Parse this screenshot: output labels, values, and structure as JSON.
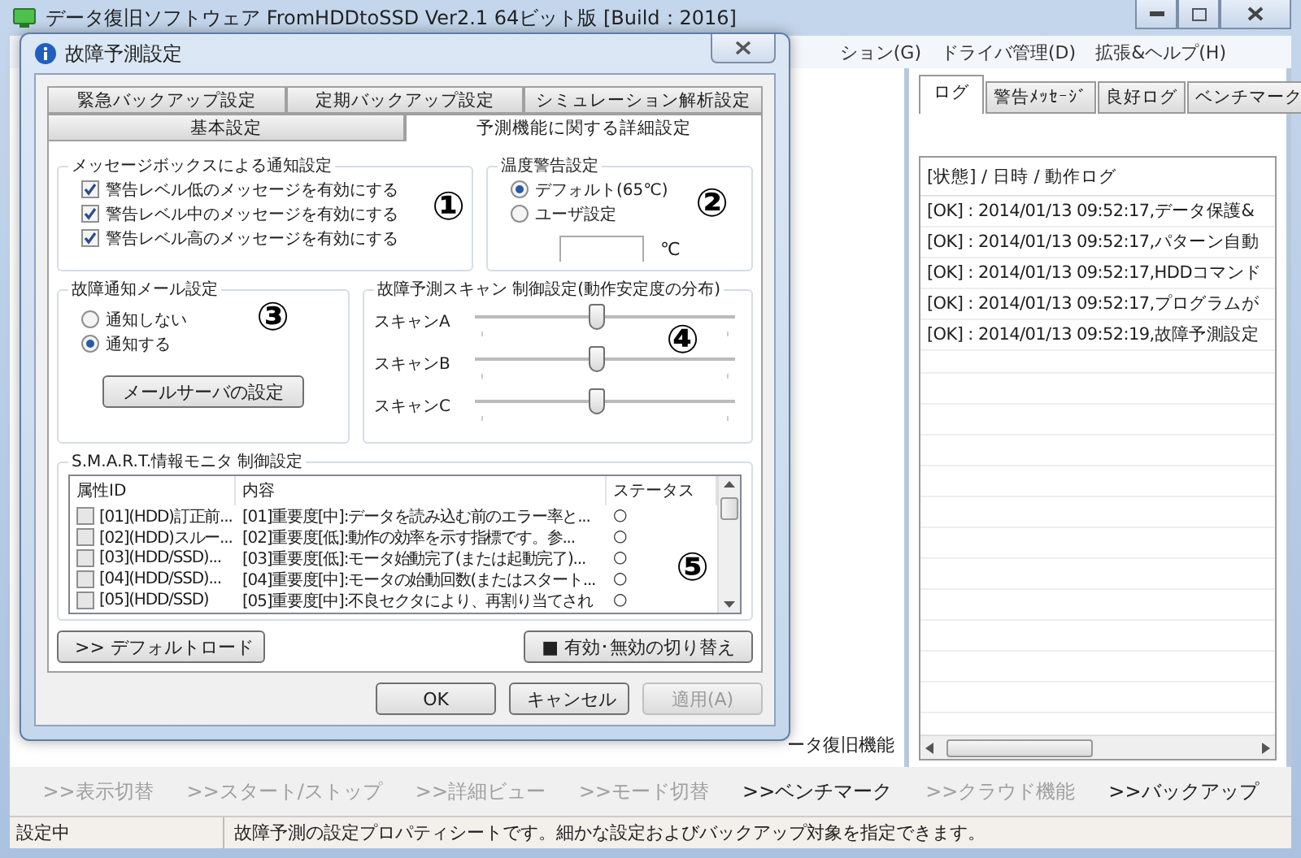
{
  "main_window": {
    "title": "データ復旧ソフトウェア FromHDDtoSSD Ver2.1 64ビット版 [Build：2016]"
  },
  "menu": [
    "ション(G)",
    "ドライバ管理(D)",
    "拡張&ヘルプ(H)"
  ],
  "background_label": "ータ復旧機能",
  "log_panel": {
    "tabs": [
      {
        "label": "ログ",
        "selected": true
      },
      {
        "label": "警告ﾒｯｾｰｼﾞ",
        "selected": false
      },
      {
        "label": "良好ログ",
        "selected": false
      },
      {
        "label": "ベンチマーク",
        "selected": false
      }
    ],
    "header": "[状態] / 日時 / 動作ログ",
    "rows": [
      "[OK] : 2014/01/13 09:52:17,データ保護&",
      "[OK] : 2014/01/13 09:52:17,パターン自動",
      "[OK] : 2014/01/13 09:52:17,HDDコマンド",
      "[OK] : 2014/01/13 09:52:17,プログラムが",
      "[OK] : 2014/01/13 09:52:19,故障予測設定"
    ]
  },
  "action_bar": [
    {
      "label": ">>表示切替",
      "disabled": true
    },
    {
      "label": ">>スタート/ストップ",
      "disabled": true
    },
    {
      "label": ">>詳細ビュー",
      "disabled": true
    },
    {
      "label": ">>モード切替",
      "disabled": true
    },
    {
      "label": ">>ベンチマーク",
      "disabled": false
    },
    {
      "label": ">>クラウド機能",
      "disabled": true
    },
    {
      "label": ">>バックアップ",
      "disabled": false
    }
  ],
  "status_bar": {
    "state": "設定中",
    "message": "故障予測の設定プロパティシートです。細かな設定およびバックアップ対象を指定できます。"
  },
  "dialog": {
    "title": "故障予測設定",
    "tabs_row_1": [
      {
        "label": "緊急バックアップ設定",
        "selected": false
      },
      {
        "label": "定期バックアップ設定",
        "selected": false
      },
      {
        "label": "シミュレーション解析設定",
        "selected": false
      }
    ],
    "tabs_row_2": [
      {
        "label": "基本設定",
        "selected": false
      },
      {
        "label": "予測機能に関する詳細設定",
        "selected": true
      }
    ],
    "message_group": {
      "title": "メッセージボックスによる通知設定",
      "marker": "①",
      "items": [
        {
          "label": "警告レベル低のメッセージを有効にする",
          "checked": true
        },
        {
          "label": "警告レベル中のメッセージを有効にする",
          "checked": true
        },
        {
          "label": "警告レベル高のメッセージを有効にする",
          "checked": true
        }
      ]
    },
    "temperature_group": {
      "title": "温度警告設定",
      "marker": "②",
      "options": [
        {
          "label": "デフォルト(65℃)",
          "selected": true
        },
        {
          "label": "ユーザ設定",
          "selected": false
        }
      ],
      "unit": "℃"
    },
    "mail_group": {
      "title": "故障通知メール設定",
      "marker": "③",
      "options": [
        {
          "label": "通知しない",
          "selected": false
        },
        {
          "label": "通知する",
          "selected": true
        }
      ],
      "button": "メールサーバの設定"
    },
    "scan_group": {
      "title": "故障予測スキャン 制御設定(動作安定度の分布)",
      "marker": "④",
      "sliders": [
        {
          "label": "スキャンA",
          "level": 0.47
        },
        {
          "label": "スキャンB",
          "level": 0.47
        },
        {
          "label": "スキャンC",
          "level": 0.47
        }
      ]
    },
    "smart_group": {
      "title": "S.M.A.R.T.情報モニタ 制御設定",
      "marker": "⑤",
      "columns": [
        "属性ID",
        "内容",
        "ステータス"
      ],
      "rows": [
        {
          "id": "[01](HDD)訂正前...",
          "content": "[01]重要度[中]:データを読み込む前のエラー率と...",
          "status": "○",
          "checked": false
        },
        {
          "id": "[02](HDD)スルー...",
          "content": "[02]重要度[低]:動作の効率を示す指標です。参...",
          "status": "○",
          "checked": false
        },
        {
          "id": "[03](HDD/SSD)...",
          "content": "[03]重要度[低]:モータ始動完了(または起動完了)...",
          "status": "○",
          "checked": false
        },
        {
          "id": "[04](HDD/SSD)...",
          "content": "[04]重要度[中]:モータの始動回数(またはスタート...",
          "status": "○",
          "checked": false
        },
        {
          "id": "[05](HDD/SSD)",
          "content": "[05]重要度[中]:不良セクタにより、再割り当てされ",
          "status": "○",
          "checked": false
        }
      ]
    },
    "default_button": ">> デフォルトロード",
    "toggle_button": "■ 有効･無効の切り替え",
    "buttons": [
      {
        "label": "OK",
        "disabled": false
      },
      {
        "label": "キャンセル",
        "disabled": false
      },
      {
        "label": "適用(A)",
        "disabled": true
      }
    ]
  }
}
